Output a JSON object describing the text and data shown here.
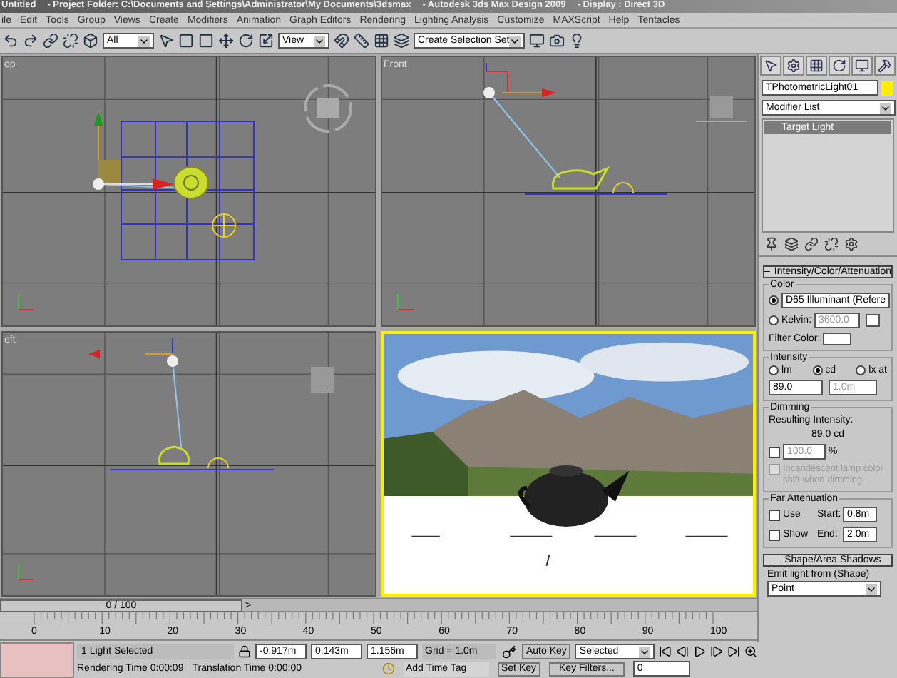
{
  "title_bar": {
    "segments": [
      "Untitled",
      "- Project Folder: C:\\Documents and Settings\\Administrator\\My Documents\\3dsmax",
      "- Autodesk 3ds Max Design 2009",
      "- Display : Direct 3D"
    ]
  },
  "menu": [
    "ile",
    "Edit",
    "Tools",
    "Group",
    "Views",
    "Create",
    "Modifiers",
    "Animation",
    "Graph Editors",
    "Rendering",
    "Lighting Analysis",
    "Customize",
    "MAXScript",
    "Help",
    "Tentacles"
  ],
  "toolbar": {
    "selection_filter": "All",
    "reference_coord": "View",
    "named_selection": "Create Selection Set"
  },
  "viewports": [
    {
      "kind": "top",
      "label": "op",
      "active": false
    },
    {
      "kind": "front",
      "label": "Front",
      "active": false
    },
    {
      "kind": "left",
      "label": "eft",
      "active": false
    },
    {
      "kind": "perspective",
      "active": true
    }
  ],
  "command_panel": {
    "object_name": "TPhotometricLight01",
    "modifier_list": "Modifier List",
    "stack": [
      {
        "label": "Target Light",
        "selected": true
      }
    ],
    "rollout": {
      "collapse_sign": "–",
      "title": "Intensity/Color/Attenuation",
      "color": {
        "title": "Color",
        "options": [
          {
            "label": "D65 Illuminant (Refere",
            "kind": "dropdown",
            "selected": true
          },
          {
            "label": "Kelvin:",
            "kind": "spinner",
            "value": "3600.0",
            "selected": false
          }
        ],
        "filter_label": "Filter Color:"
      },
      "intensity": {
        "title": "Intensity",
        "units": [
          {
            "label": "lm",
            "selected": false
          },
          {
            "label": "cd",
            "selected": true
          },
          {
            "label": "lx at",
            "selected": false
          }
        ],
        "value": "89.0",
        "distance": "1.0m"
      },
      "dimming": {
        "title": "Dimming",
        "resulting_label": "Resulting Intensity:",
        "resulting_value": "89.0 cd",
        "percent_checked": false,
        "percent": "100.0",
        "percent_sign": "%",
        "incandescent": {
          "label": "Incandescent lamp color shift when dimming",
          "checked": false,
          "disabled": true
        }
      },
      "far_attenuation": {
        "title": "Far Attenuation",
        "use": {
          "label": "Use",
          "checked": false
        },
        "show": {
          "label": "Show",
          "checked": false
        },
        "start_label": "Start:",
        "start": "0.8m",
        "end_label": "End:",
        "end": "2.0m"
      }
    },
    "shadows_rollout": {
      "collapse_sign": "–",
      "title": "Shape/Area Shadows",
      "emit_label": "Emit light from (Shape)",
      "emit_value": "Point"
    }
  },
  "time_slider": {
    "position": "0 / 100",
    "next": ">"
  },
  "ruler_labels": [
    "0",
    "10",
    "20",
    "30",
    "40",
    "50",
    "60",
    "70",
    "80",
    "90",
    "100"
  ],
  "status": {
    "selection": "1 Light Selected",
    "x": "-0.917m",
    "y": "0.143m",
    "z": "1.156m",
    "grid": "Grid = 1.0m",
    "auto_key": "Auto Key",
    "key_mode": "Selected",
    "set_key": "Set Key",
    "key_filters": "Key Filters...",
    "frame": "0",
    "rendering_time": "Rendering Time  0:00:09",
    "translation_time": "Translation Time  0:00:00",
    "add_time_tag": "Add Time Tag"
  }
}
